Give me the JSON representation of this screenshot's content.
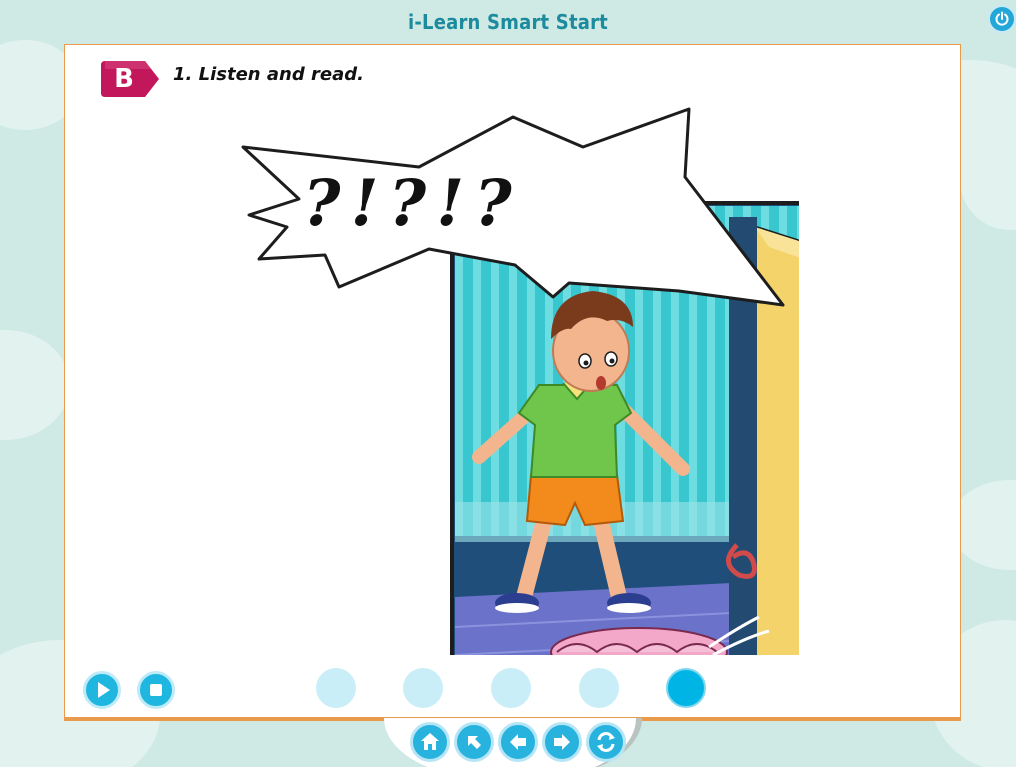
{
  "app": {
    "title": "i-Learn Smart Start"
  },
  "activity": {
    "section_label": "B",
    "instruction": "1. Listen and read."
  },
  "illustration": {
    "exclamation_text": "?!?!?"
  },
  "audio_controls": [
    {
      "name": "play-button",
      "icon": "play-icon"
    },
    {
      "name": "stop-button",
      "icon": "stop-icon"
    }
  ],
  "pagination": {
    "pages": 5,
    "current_page": 5
  },
  "bottom_nav": [
    {
      "name": "home-button",
      "icon": "home-icon"
    },
    {
      "name": "back-to-menu-button",
      "icon": "arrow-up-left-icon"
    },
    {
      "name": "previous-button",
      "icon": "arrow-left-icon"
    },
    {
      "name": "next-button",
      "icon": "arrow-right-icon"
    },
    {
      "name": "refresh-button",
      "icon": "refresh-icon"
    }
  ],
  "colors": {
    "accent": "#1fb7e0",
    "panel_border": "#e99a4a",
    "section_tag": "#c2185b",
    "title": "#1c8b9e"
  }
}
